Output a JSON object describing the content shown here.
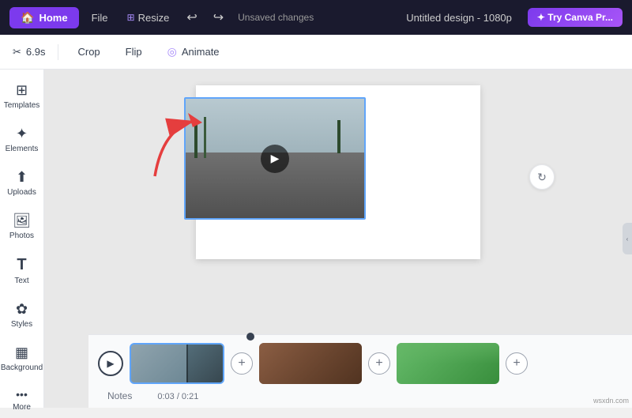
{
  "navbar": {
    "home_label": "Home",
    "file_label": "File",
    "resize_label": "Resize",
    "undo_symbol": "↩",
    "redo_symbol": "↪",
    "unsaved_label": "Unsaved changes",
    "title": "Untitled design - 1080p",
    "try_label": "✦ Try Canva Pr..."
  },
  "toolbar": {
    "duration_label": "6.9s",
    "scissors_symbol": "✂",
    "crop_label": "Crop",
    "flip_label": "Flip",
    "animate_label": "Animate",
    "animate_icon": "◎"
  },
  "sidebar": {
    "items": [
      {
        "id": "templates",
        "icon": "⊞",
        "label": "Templates"
      },
      {
        "id": "elements",
        "icon": "✦",
        "label": "Elements"
      },
      {
        "id": "uploads",
        "icon": "↑",
        "label": "Uploads"
      },
      {
        "id": "photos",
        "icon": "🖼",
        "label": "Photos"
      },
      {
        "id": "text",
        "icon": "T",
        "label": "Text"
      },
      {
        "id": "styles",
        "icon": "✿",
        "label": "Styles"
      },
      {
        "id": "background",
        "icon": "▦",
        "label": "Background"
      },
      {
        "id": "more",
        "icon": "···",
        "label": "More"
      }
    ]
  },
  "video": {
    "play_symbol": "▶"
  },
  "timeline": {
    "play_symbol": "▶",
    "plus_symbol": "+",
    "notes_label": "Notes",
    "time_label": "0:03 / 0:21"
  },
  "watermark": "wsxdn.com"
}
